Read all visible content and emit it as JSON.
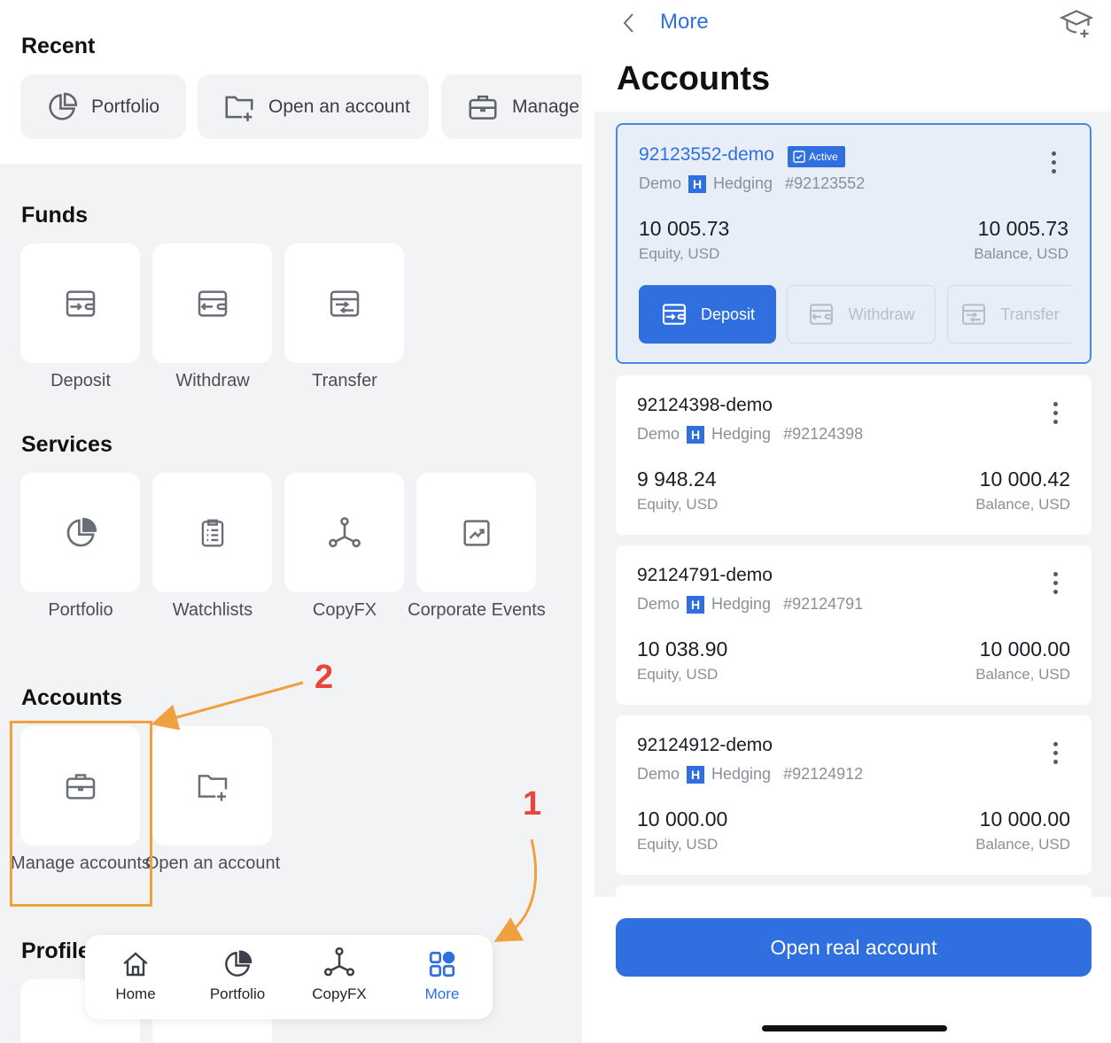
{
  "left": {
    "recent": {
      "title": "Recent",
      "items": [
        "Portfolio",
        "Open an account",
        "Manage"
      ]
    },
    "funds": {
      "title": "Funds",
      "items": [
        "Deposit",
        "Withdraw",
        "Transfer"
      ]
    },
    "services": {
      "title": "Services",
      "items": [
        "Portfolio",
        "Watchlists",
        "CopyFX",
        "Corporate Events"
      ]
    },
    "accounts": {
      "title": "Accounts",
      "items": [
        "Manage accounts",
        "Open an account"
      ]
    },
    "profile": {
      "title": "Profile"
    },
    "annotations": {
      "step1": "1",
      "step2": "2"
    },
    "nav": {
      "items": [
        {
          "label": "Home",
          "icon": "home-icon"
        },
        {
          "label": "Portfolio",
          "icon": "pie-chart-icon"
        },
        {
          "label": "CopyFX",
          "icon": "network-icon"
        },
        {
          "label": "More",
          "icon": "grid-icon"
        }
      ],
      "active": "More"
    }
  },
  "right": {
    "header": {
      "back_label": "More",
      "title": "Accounts"
    },
    "accounts": [
      {
        "name": "92123552-demo",
        "badge": "Active",
        "type": "Demo",
        "mode": "Hedging",
        "number": "#92123552",
        "equity": "10 005.73",
        "equity_label": "Equity, USD",
        "balance": "10 005.73",
        "balance_label": "Balance, USD",
        "actions": [
          "Deposit",
          "Withdraw",
          "Transfer"
        ]
      },
      {
        "name": "92124398-demo",
        "type": "Demo",
        "mode": "Hedging",
        "number": "#92124398",
        "equity": "9 948.24",
        "equity_label": "Equity, USD",
        "balance": "10 000.42",
        "balance_label": "Balance, USD"
      },
      {
        "name": "92124791-demo",
        "type": "Demo",
        "mode": "Hedging",
        "number": "#92124791",
        "equity": "10 038.90",
        "equity_label": "Equity, USD",
        "balance": "10 000.00",
        "balance_label": "Balance, USD"
      },
      {
        "name": "92124912-demo",
        "type": "Demo",
        "mode": "Hedging",
        "number": "#92124912",
        "equity": "10 000.00",
        "equity_label": "Equity, USD",
        "balance": "10 000.00",
        "balance_label": "Balance, USD"
      }
    ],
    "hedging_badge": "H",
    "open_real_label": "Open real account"
  },
  "colors": {
    "accent": "#2f6fe0",
    "annotation_box": "#f0a03d",
    "annotation_number": "#e8453c",
    "background": "#f2f3f5"
  }
}
